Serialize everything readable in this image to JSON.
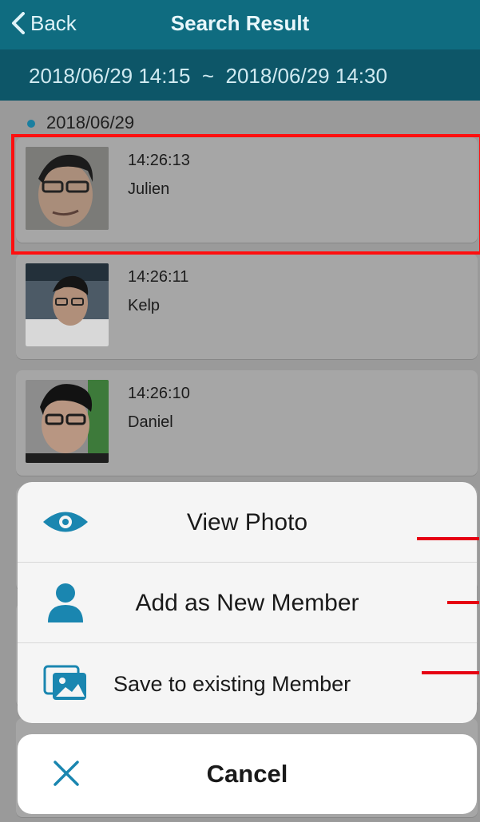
{
  "nav": {
    "back_label": "Back",
    "title": "Search Result"
  },
  "range": {
    "text": "2018/06/29 14:15  ~  2018/06/29 14:30"
  },
  "list": {
    "date": "2018/06/29",
    "items": [
      {
        "time": "14:26:13",
        "name": "Julien"
      },
      {
        "time": "14:26:11",
        "name": "Kelp"
      },
      {
        "time": "14:26:10",
        "name": "Daniel"
      }
    ]
  },
  "sheet": {
    "view_photo": "View Photo",
    "add_member": "Add as New Member",
    "save_existing": "Save to existing Member",
    "cancel": "Cancel"
  },
  "colors": {
    "nav": "#0f6c80",
    "range_bar": "#0d5668",
    "accent": "#1a86b0",
    "highlight": "#ff0f0f"
  }
}
